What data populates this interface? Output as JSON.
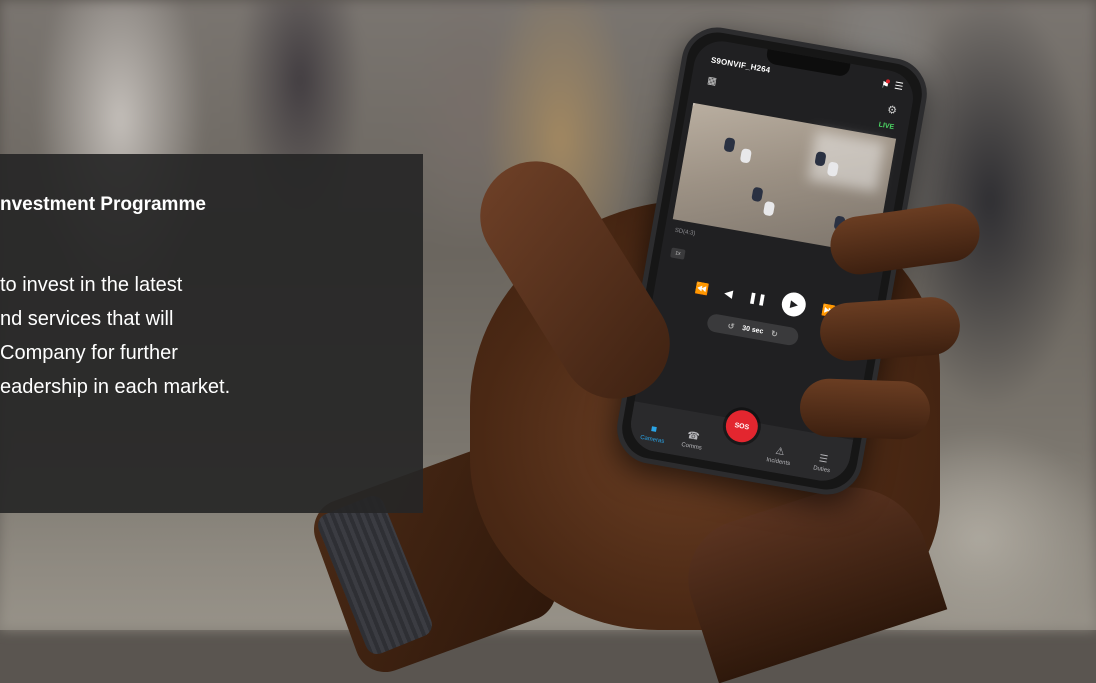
{
  "overlay": {
    "title": "nvestment Programme",
    "lines": [
      "to invest in the latest",
      "nd services that will",
      "Company for further",
      "eadership in each market."
    ]
  },
  "phone_app": {
    "camera_name": "S9ONVIF_H264",
    "status": "LIVE",
    "resolution": "SD(4:3)",
    "speed": "1x",
    "seek_label": "30 sec",
    "sos_label": "SOS",
    "tabs": [
      {
        "label": "Cameras",
        "icon": "video-camera-icon",
        "active": true
      },
      {
        "label": "Comms",
        "icon": "phone-icon",
        "active": false
      },
      {
        "label": "Incidents",
        "icon": "warning-icon",
        "active": false
      },
      {
        "label": "Duties",
        "icon": "checklist-icon",
        "active": false
      }
    ],
    "colors": {
      "live": "#4cd964",
      "sos": "#e3262f",
      "active_tab": "#2aa4e6"
    }
  }
}
